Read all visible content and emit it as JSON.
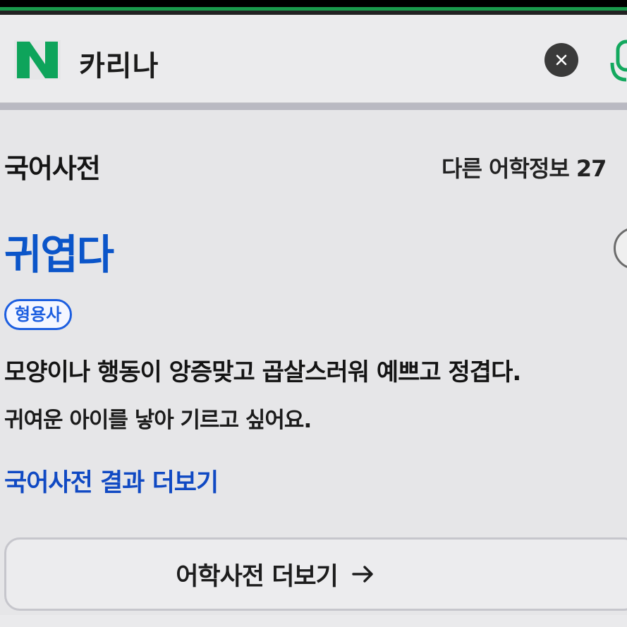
{
  "search": {
    "query": "카리나",
    "logo_letter": "N",
    "clear_icon": "close-icon",
    "voice_icon": "microphone-icon"
  },
  "dictionary": {
    "section_title": "국어사전",
    "other_info": "다른 어학정보 27",
    "headword": "귀엽다",
    "part_of_speech": "형용사",
    "definition": "모양이나 행동이 앙증맞고 곱살스러워 예쁘고 정겹다.",
    "example": "귀여운 아이를 낳아 기르고 싶어요.",
    "more_link": "국어사전 결과 더보기",
    "more_button": "어학사전 더보기"
  },
  "colors": {
    "brand_green": "#03c75a",
    "link_blue": "#0b55c9",
    "badge_blue": "#1c5ee0"
  }
}
